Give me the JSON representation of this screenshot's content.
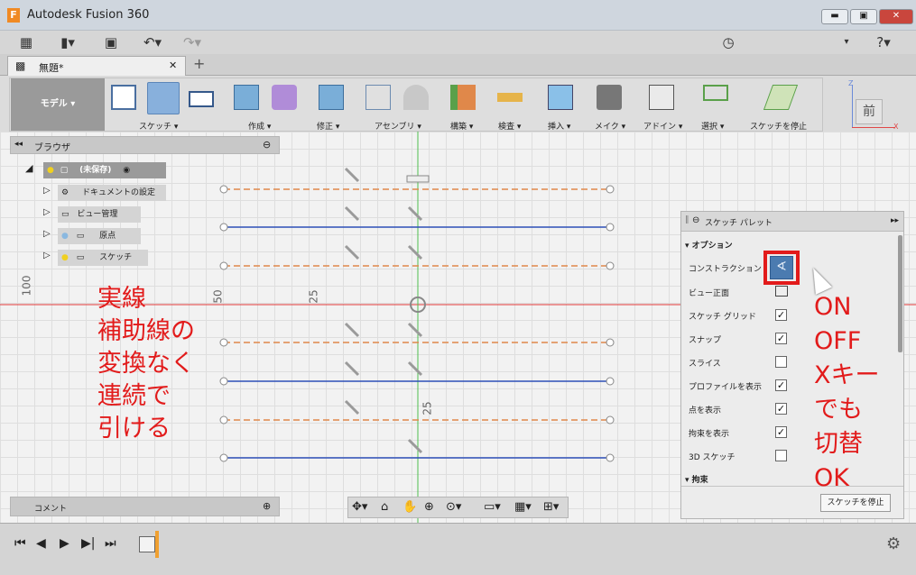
{
  "window": {
    "title": "Autodesk Fusion 360",
    "min": "▬",
    "max": "▣",
    "close": "✕"
  },
  "doc_tab": {
    "label": "無題*",
    "close": "✕",
    "add": "+"
  },
  "ribbon": {
    "mode_label": "モデル ▾",
    "groups": [
      "スケッチ ▾",
      "作成 ▾",
      "修正 ▾",
      "アセンブリ ▾",
      "構築 ▾",
      "検査 ▾",
      "挿入 ▾",
      "メイク ▾",
      "アドイン ▾",
      "選択 ▾",
      "スケッチを停止"
    ]
  },
  "viewcube": {
    "face": "前",
    "z": "Z",
    "x": "X"
  },
  "browser": {
    "title": "ブラウザ",
    "root": "(未保存)",
    "items": [
      "ドキュメントの設定",
      "ビュー管理",
      "原点",
      "スケッチ"
    ]
  },
  "dimensions": {
    "d100": "100",
    "d50": "50",
    "d25a": "25",
    "d25b": "25"
  },
  "palette": {
    "title": "スケッチ パレット",
    "section_options": "オプション",
    "rows": [
      {
        "label": "コンストラクション"
      },
      {
        "label": "ビュー正面"
      },
      {
        "label": "スケッチ グリッド",
        "checked": "✓"
      },
      {
        "label": "スナップ",
        "checked": "✓"
      },
      {
        "label": "スライス",
        "checked": ""
      },
      {
        "label": "プロファイルを表示",
        "checked": "✓"
      },
      {
        "label": "点を表示",
        "checked": "✓"
      },
      {
        "label": "拘束を表示",
        "checked": "✓"
      },
      {
        "label": "3D スケッチ",
        "checked": ""
      }
    ],
    "section_constraints": "拘束",
    "stop_button": "スケッチを停止"
  },
  "comment": {
    "label": "コメント"
  },
  "annotations": {
    "left": [
      "実線",
      "補助線の",
      "変換なく",
      "連続で",
      "引ける"
    ],
    "right": [
      "ON",
      "OFF",
      "Xキー",
      "でも",
      "切替",
      "OK"
    ]
  },
  "colors": {
    "solid_line": "#2d4fb8",
    "construction_line": "#e0884a",
    "annotation": "#e21b1b",
    "highlight_box": "#e21b1b"
  }
}
